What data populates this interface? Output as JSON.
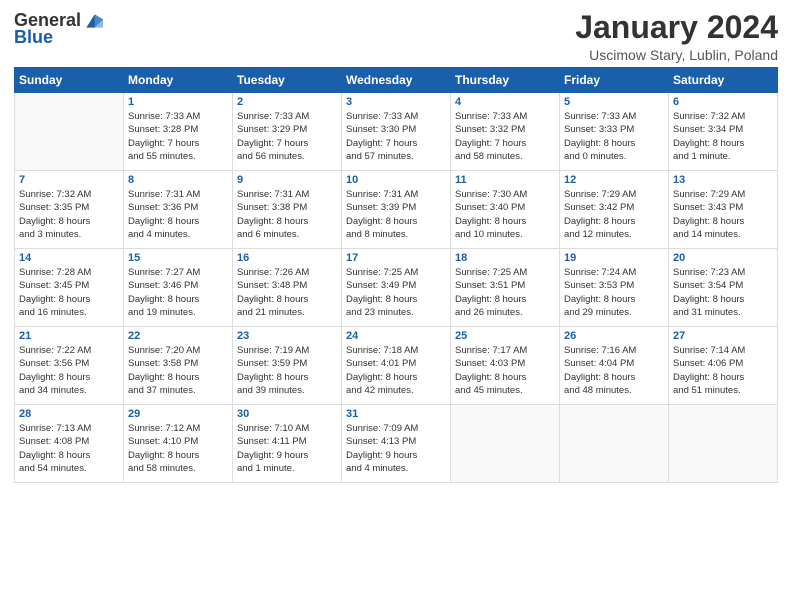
{
  "header": {
    "logo_general": "General",
    "logo_blue": "Blue",
    "title": "January 2024",
    "location": "Uscimow Stary, Lublin, Poland"
  },
  "calendar": {
    "headers": [
      "Sunday",
      "Monday",
      "Tuesday",
      "Wednesday",
      "Thursday",
      "Friday",
      "Saturday"
    ],
    "weeks": [
      [
        {
          "day": "",
          "info": ""
        },
        {
          "day": "1",
          "info": "Sunrise: 7:33 AM\nSunset: 3:28 PM\nDaylight: 7 hours\nand 55 minutes."
        },
        {
          "day": "2",
          "info": "Sunrise: 7:33 AM\nSunset: 3:29 PM\nDaylight: 7 hours\nand 56 minutes."
        },
        {
          "day": "3",
          "info": "Sunrise: 7:33 AM\nSunset: 3:30 PM\nDaylight: 7 hours\nand 57 minutes."
        },
        {
          "day": "4",
          "info": "Sunrise: 7:33 AM\nSunset: 3:32 PM\nDaylight: 7 hours\nand 58 minutes."
        },
        {
          "day": "5",
          "info": "Sunrise: 7:33 AM\nSunset: 3:33 PM\nDaylight: 8 hours\nand 0 minutes."
        },
        {
          "day": "6",
          "info": "Sunrise: 7:32 AM\nSunset: 3:34 PM\nDaylight: 8 hours\nand 1 minute."
        }
      ],
      [
        {
          "day": "7",
          "info": "Sunrise: 7:32 AM\nSunset: 3:35 PM\nDaylight: 8 hours\nand 3 minutes."
        },
        {
          "day": "8",
          "info": "Sunrise: 7:31 AM\nSunset: 3:36 PM\nDaylight: 8 hours\nand 4 minutes."
        },
        {
          "day": "9",
          "info": "Sunrise: 7:31 AM\nSunset: 3:38 PM\nDaylight: 8 hours\nand 6 minutes."
        },
        {
          "day": "10",
          "info": "Sunrise: 7:31 AM\nSunset: 3:39 PM\nDaylight: 8 hours\nand 8 minutes."
        },
        {
          "day": "11",
          "info": "Sunrise: 7:30 AM\nSunset: 3:40 PM\nDaylight: 8 hours\nand 10 minutes."
        },
        {
          "day": "12",
          "info": "Sunrise: 7:29 AM\nSunset: 3:42 PM\nDaylight: 8 hours\nand 12 minutes."
        },
        {
          "day": "13",
          "info": "Sunrise: 7:29 AM\nSunset: 3:43 PM\nDaylight: 8 hours\nand 14 minutes."
        }
      ],
      [
        {
          "day": "14",
          "info": "Sunrise: 7:28 AM\nSunset: 3:45 PM\nDaylight: 8 hours\nand 16 minutes."
        },
        {
          "day": "15",
          "info": "Sunrise: 7:27 AM\nSunset: 3:46 PM\nDaylight: 8 hours\nand 19 minutes."
        },
        {
          "day": "16",
          "info": "Sunrise: 7:26 AM\nSunset: 3:48 PM\nDaylight: 8 hours\nand 21 minutes."
        },
        {
          "day": "17",
          "info": "Sunrise: 7:25 AM\nSunset: 3:49 PM\nDaylight: 8 hours\nand 23 minutes."
        },
        {
          "day": "18",
          "info": "Sunrise: 7:25 AM\nSunset: 3:51 PM\nDaylight: 8 hours\nand 26 minutes."
        },
        {
          "day": "19",
          "info": "Sunrise: 7:24 AM\nSunset: 3:53 PM\nDaylight: 8 hours\nand 29 minutes."
        },
        {
          "day": "20",
          "info": "Sunrise: 7:23 AM\nSunset: 3:54 PM\nDaylight: 8 hours\nand 31 minutes."
        }
      ],
      [
        {
          "day": "21",
          "info": "Sunrise: 7:22 AM\nSunset: 3:56 PM\nDaylight: 8 hours\nand 34 minutes."
        },
        {
          "day": "22",
          "info": "Sunrise: 7:20 AM\nSunset: 3:58 PM\nDaylight: 8 hours\nand 37 minutes."
        },
        {
          "day": "23",
          "info": "Sunrise: 7:19 AM\nSunset: 3:59 PM\nDaylight: 8 hours\nand 39 minutes."
        },
        {
          "day": "24",
          "info": "Sunrise: 7:18 AM\nSunset: 4:01 PM\nDaylight: 8 hours\nand 42 minutes."
        },
        {
          "day": "25",
          "info": "Sunrise: 7:17 AM\nSunset: 4:03 PM\nDaylight: 8 hours\nand 45 minutes."
        },
        {
          "day": "26",
          "info": "Sunrise: 7:16 AM\nSunset: 4:04 PM\nDaylight: 8 hours\nand 48 minutes."
        },
        {
          "day": "27",
          "info": "Sunrise: 7:14 AM\nSunset: 4:06 PM\nDaylight: 8 hours\nand 51 minutes."
        }
      ],
      [
        {
          "day": "28",
          "info": "Sunrise: 7:13 AM\nSunset: 4:08 PM\nDaylight: 8 hours\nand 54 minutes."
        },
        {
          "day": "29",
          "info": "Sunrise: 7:12 AM\nSunset: 4:10 PM\nDaylight: 8 hours\nand 58 minutes."
        },
        {
          "day": "30",
          "info": "Sunrise: 7:10 AM\nSunset: 4:11 PM\nDaylight: 9 hours\nand 1 minute."
        },
        {
          "day": "31",
          "info": "Sunrise: 7:09 AM\nSunset: 4:13 PM\nDaylight: 9 hours\nand 4 minutes."
        },
        {
          "day": "",
          "info": ""
        },
        {
          "day": "",
          "info": ""
        },
        {
          "day": "",
          "info": ""
        }
      ]
    ]
  }
}
